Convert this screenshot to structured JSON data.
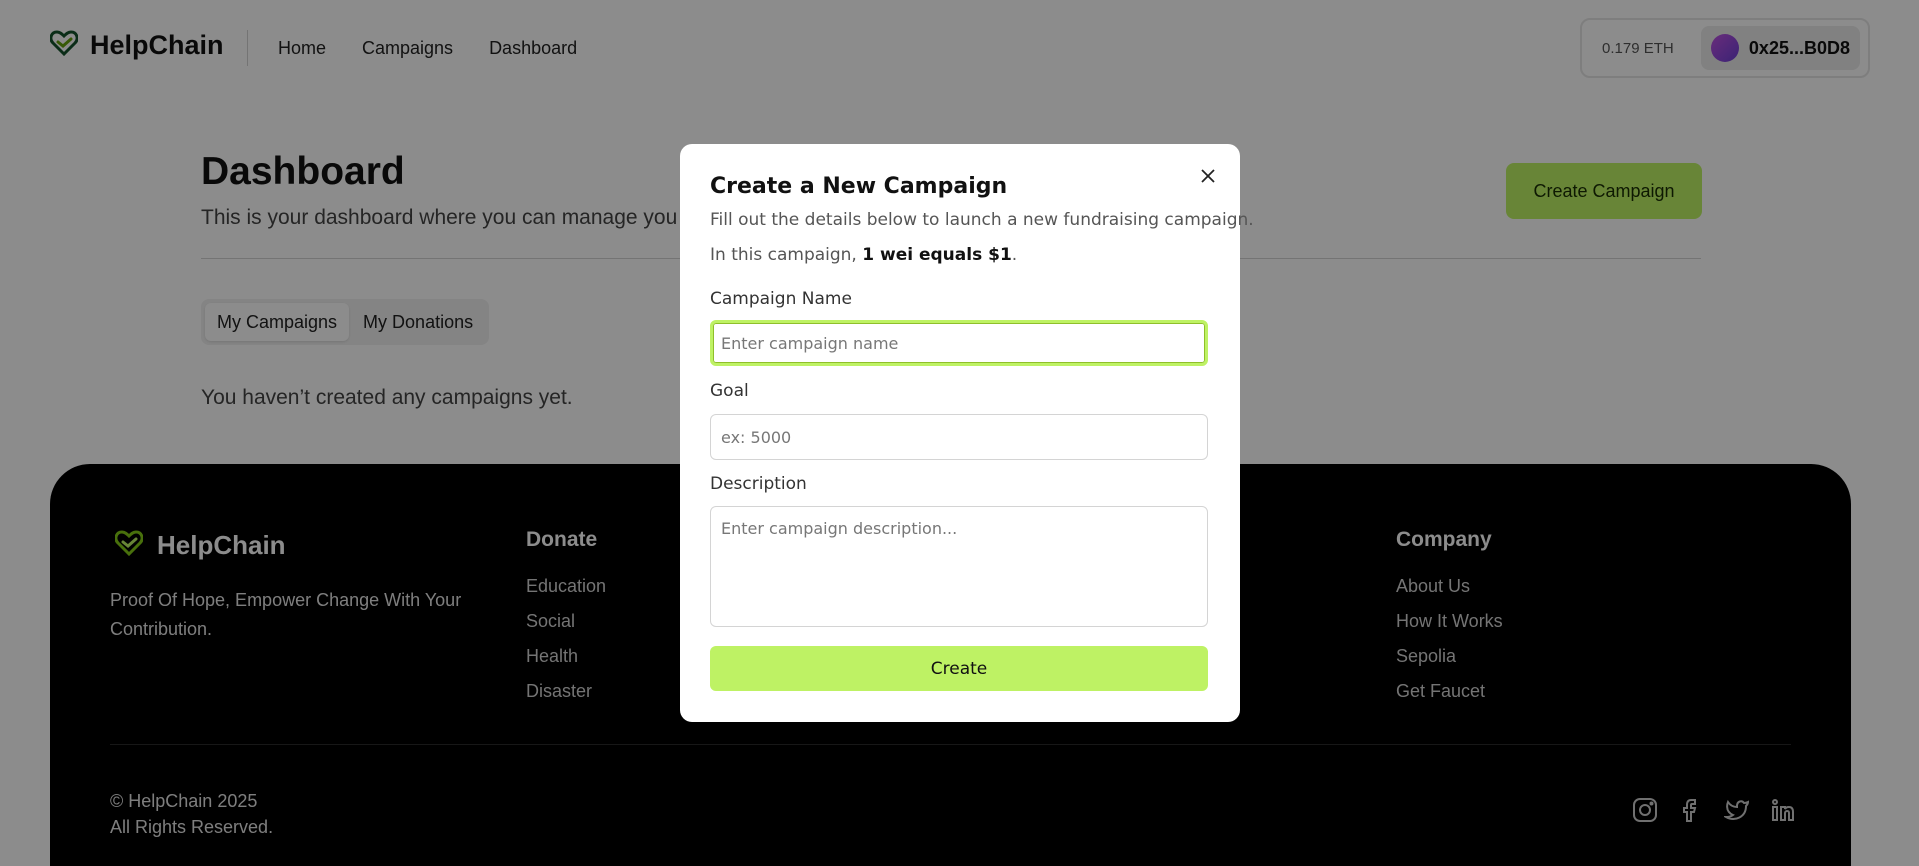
{
  "header": {
    "brand": "HelpChain",
    "nav": [
      {
        "label": "Home"
      },
      {
        "label": "Campaigns"
      },
      {
        "label": "Dashboard"
      }
    ],
    "wallet": {
      "balance": "0.179 ETH",
      "address": "0x25...B0D8"
    }
  },
  "dashboard": {
    "title": "Dashboard",
    "subtitle": "This is your dashboard where you can manage you",
    "create_button": "Create Campaign",
    "tabs": [
      {
        "label": "My Campaigns",
        "active": true
      },
      {
        "label": "My Donations",
        "active": false
      }
    ],
    "empty_message": "You haven’t created any campaigns yet."
  },
  "footer": {
    "brand": "HelpChain",
    "tagline": "Proof Of Hope, Empower Change With Your Contribution.",
    "columns": [
      {
        "title": "Donate",
        "items": [
          "Education",
          "Social",
          "Health",
          "Disaster"
        ]
      },
      {
        "title": "Company",
        "items": [
          "About Us",
          "How It Works",
          "Sepolia",
          "Get Faucet"
        ]
      }
    ],
    "copyright_line1": "© HelpChain 2025",
    "copyright_line2": "All Rights Reserved.",
    "socials": [
      "instagram-icon",
      "facebook-icon",
      "twitter-icon",
      "linkedin-icon"
    ]
  },
  "modal": {
    "title": "Create a New Campaign",
    "description": "Fill out the details below to launch a new fundraising campaign.",
    "note_prefix": "In this campaign, ",
    "note_bold": "1 wei equals $1",
    "note_suffix": ".",
    "fields": {
      "name": {
        "label": "Campaign Name",
        "placeholder": "Enter campaign name",
        "value": ""
      },
      "goal": {
        "label": "Goal",
        "placeholder": "ex: 5000",
        "value": ""
      },
      "description": {
        "label": "Description",
        "placeholder": "Enter campaign description...",
        "value": ""
      }
    },
    "submit_label": "Create"
  },
  "colors": {
    "accent": "#bef264",
    "overlay": "rgba(0,0,0,0.45)",
    "footer_bg": "#000000"
  }
}
